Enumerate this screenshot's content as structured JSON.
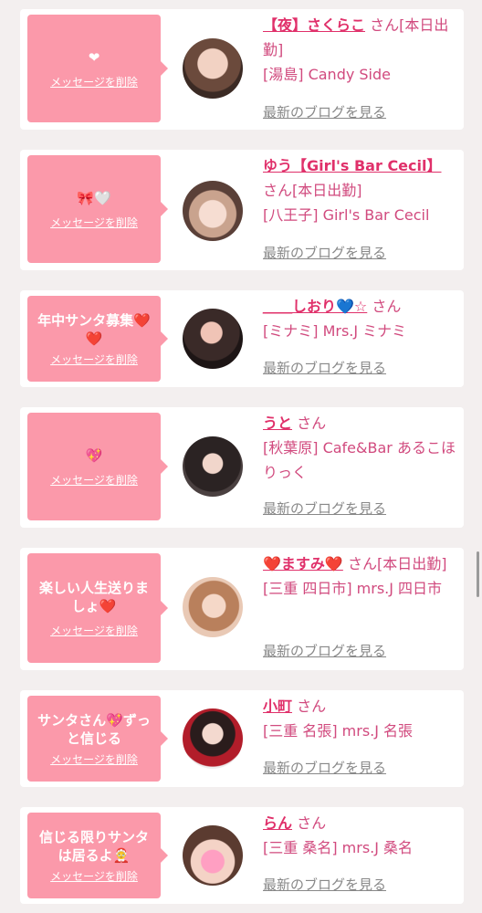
{
  "colors": {
    "bubble": "#fb99aa",
    "name": "#e0306a",
    "text": "#d14a7e",
    "link": "#888888"
  },
  "common": {
    "delete_label": "メッセージを削除",
    "blog_label": "最新のブログを見る"
  },
  "cards": [
    {
      "message": "❤",
      "name": "【夜】さくらこ",
      "san": "さん",
      "status": "[本日出勤]",
      "shop": "[湯島] Candy Side"
    },
    {
      "message": "🎀🤍",
      "name": "ゆう【Girl's Bar Cecil】",
      "san": "さん",
      "status": "[本日出勤]",
      "shop": "[八王子] Girl's Bar Cecil"
    },
    {
      "message": "年中サンタ募集❤️❤️",
      "name": "＿＿しおり💙☆",
      "san": "さん",
      "status": "",
      "shop": "[ミナミ] Mrs.J ミナミ"
    },
    {
      "message": "💖",
      "name": "うと",
      "san": "さん",
      "status": "",
      "shop": "[秋葉原] Cafe&Bar あるこほりっく"
    },
    {
      "message": "楽しい人生送りましょ❤️",
      "name": "❤️ますみ❤️",
      "san": "さん",
      "status": "[本日出勤]",
      "shop": "[三重 四日市] mrs.J 四日市"
    },
    {
      "message": "サンタさん💖ずっと信じる",
      "name": "小町",
      "san": "さん",
      "status": "",
      "shop": "[三重 名張] mrs.J 名張"
    },
    {
      "message": "信じる限りサンタは居るよ🤶",
      "name": "らん",
      "san": "さん",
      "status": "",
      "shop": "[三重 桑名] mrs.J 桑名"
    }
  ]
}
